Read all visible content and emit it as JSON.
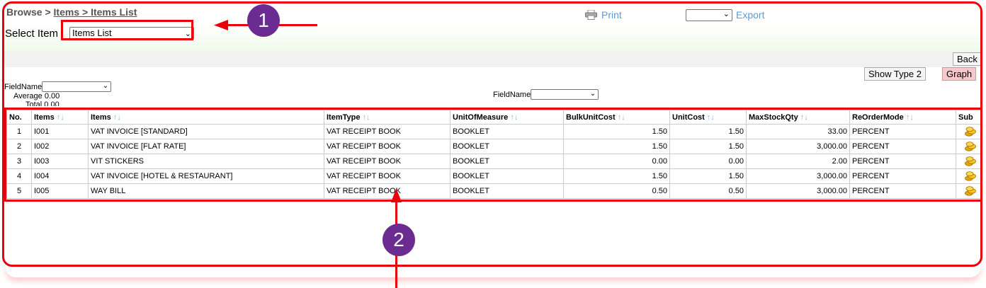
{
  "breadcrumb": {
    "part1": "Browse > ",
    "part2": "Items > ",
    "part3": "Items List"
  },
  "select_item": {
    "label": "Select Item",
    "selected": "Items List"
  },
  "toolbar": {
    "print_label": "Print",
    "export_label": "Export"
  },
  "buttons": {
    "back": "Back",
    "show_type": "Show Type 2",
    "graph": "Graph"
  },
  "field_left": {
    "label": "FieldName",
    "average": "Average 0.00",
    "total": "Total 0.00"
  },
  "field_right": {
    "label": "FieldName"
  },
  "table": {
    "headers": [
      "No.",
      "Items",
      "Items",
      "ItemType",
      "UnitOfMeasure",
      "BulkUnitCost",
      "UnitCost",
      "MaxStockQty",
      "ReOrderMode",
      "Sub"
    ],
    "sort_glyph": "↑↓",
    "rows": [
      [
        "1",
        "I001",
        "VAT INVOICE [STANDARD]",
        "VAT RECEIPT BOOK",
        "BOOKLET",
        "1.50",
        "1.50",
        "33.00",
        "PERCENT"
      ],
      [
        "2",
        "I002",
        "VAT INVOICE [FLAT RATE]",
        "VAT RECEIPT BOOK",
        "BOOKLET",
        "1.50",
        "1.50",
        "3,000.00",
        "PERCENT"
      ],
      [
        "3",
        "I003",
        "VIT STICKERS",
        "VAT RECEIPT BOOK",
        "BOOKLET",
        "0.00",
        "0.00",
        "2.00",
        "PERCENT"
      ],
      [
        "4",
        "I004",
        "VAT INVOICE [HOTEL & RESTAURANT]",
        "VAT RECEIPT BOOK",
        "BOOKLET",
        "1.50",
        "1.50",
        "3,000.00",
        "PERCENT"
      ],
      [
        "5",
        "I005",
        "WAY BILL",
        "VAT RECEIPT BOOK",
        "BOOKLET",
        "0.50",
        "0.50",
        "3,000.00",
        "PERCENT"
      ]
    ]
  },
  "annotations": {
    "marker1": "1",
    "marker2": "2"
  },
  "colors": {
    "annotation_red": "#e8000b",
    "marker_purple": "#6b2c91",
    "link_blue": "#5b9bd5"
  },
  "icons": {
    "print": "printer-icon",
    "sub": "coins-icon",
    "dropdown": "chevron-down-icon"
  }
}
